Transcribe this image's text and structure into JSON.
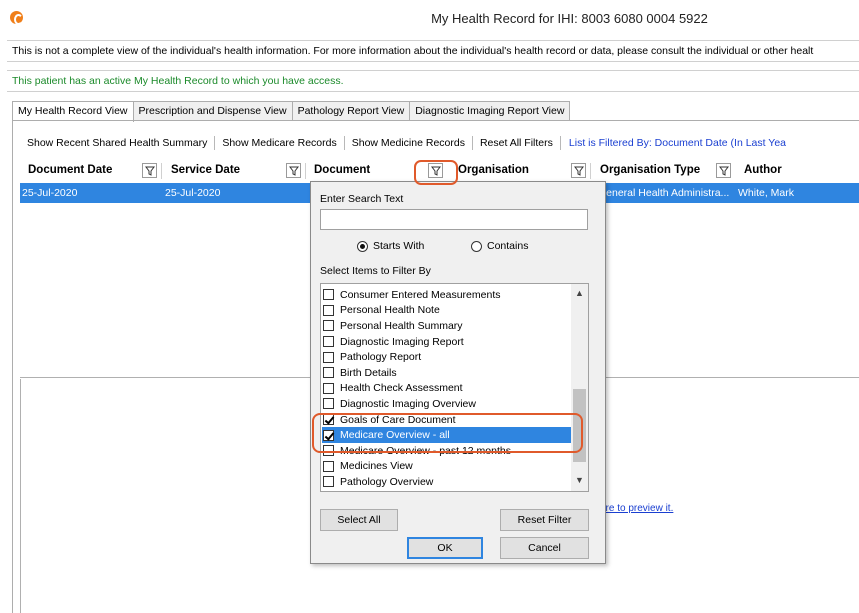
{
  "window": {
    "title": "My Health Record for IHI: 8003 6080 0004 5922"
  },
  "banner": {
    "text": "This is not a complete view of the individual's health information. For more information about the individual's health record or data, please consult the individual or other healt"
  },
  "access_note": {
    "text": "This patient has an active My Health Record to which you have access."
  },
  "tabs": [
    {
      "label": "My Health Record View",
      "active": true
    },
    {
      "label": "Prescription and Dispense View",
      "active": false
    },
    {
      "label": "Pathology Report View",
      "active": false
    },
    {
      "label": "Diagnostic Imaging Report View",
      "active": false
    }
  ],
  "toolbar": {
    "recent_summary": "Show Recent Shared Health Summary",
    "medicare_records": "Show Medicare Records",
    "medicine_records": "Show Medicine Records",
    "reset_filters": "Reset All Filters",
    "filtered_by": "List is Filtered By: Document Date (In Last Yea"
  },
  "grid": {
    "headers": {
      "document_date": "Document Date",
      "service_date": "Service Date",
      "document": "Document",
      "organisation": "Organisation",
      "organisation_type": "Organisation Type",
      "author": "Author"
    },
    "rows": [
      {
        "document_date": "25-Jul-2020",
        "service_date": "25-Jul-2020",
        "organisation_type": "General Health Administra...",
        "author": "White, Mark"
      }
    ]
  },
  "preview_link": {
    "text": "ere to preview it."
  },
  "filter_popup": {
    "search_label": "Enter Search Text",
    "search_value": "",
    "match_options": {
      "starts_with": "Starts With",
      "contains": "Contains",
      "selected": "starts_with"
    },
    "items_label": "Select Items to Filter By",
    "items": [
      {
        "label": "Consumer Entered Measurements",
        "checked": false,
        "selected": false
      },
      {
        "label": "Personal Health Note",
        "checked": false,
        "selected": false
      },
      {
        "label": "Personal Health Summary",
        "checked": false,
        "selected": false
      },
      {
        "label": "Diagnostic Imaging Report",
        "checked": false,
        "selected": false
      },
      {
        "label": "Pathology Report",
        "checked": false,
        "selected": false
      },
      {
        "label": "Birth Details",
        "checked": false,
        "selected": false
      },
      {
        "label": "Health Check Assessment",
        "checked": false,
        "selected": false
      },
      {
        "label": "Diagnostic Imaging Overview",
        "checked": false,
        "selected": false
      },
      {
        "label": "Goals of Care Document",
        "checked": true,
        "selected": false
      },
      {
        "label": "Medicare Overview - all",
        "checked": true,
        "selected": true
      },
      {
        "label": "Medicare Overview - past 12 months",
        "checked": false,
        "selected": false
      },
      {
        "label": "Medicines View",
        "checked": false,
        "selected": false
      },
      {
        "label": "Pathology Overview",
        "checked": false,
        "selected": false
      }
    ],
    "select_all_label": "Select All",
    "reset_filter_label": "Reset Filter",
    "ok_label": "OK",
    "cancel_label": "Cancel"
  },
  "colors": {
    "selection": "#2f85e0",
    "highlight_annotation": "#e05a2b",
    "access_text": "#1b8a2a",
    "link": "#1a3fd1"
  }
}
